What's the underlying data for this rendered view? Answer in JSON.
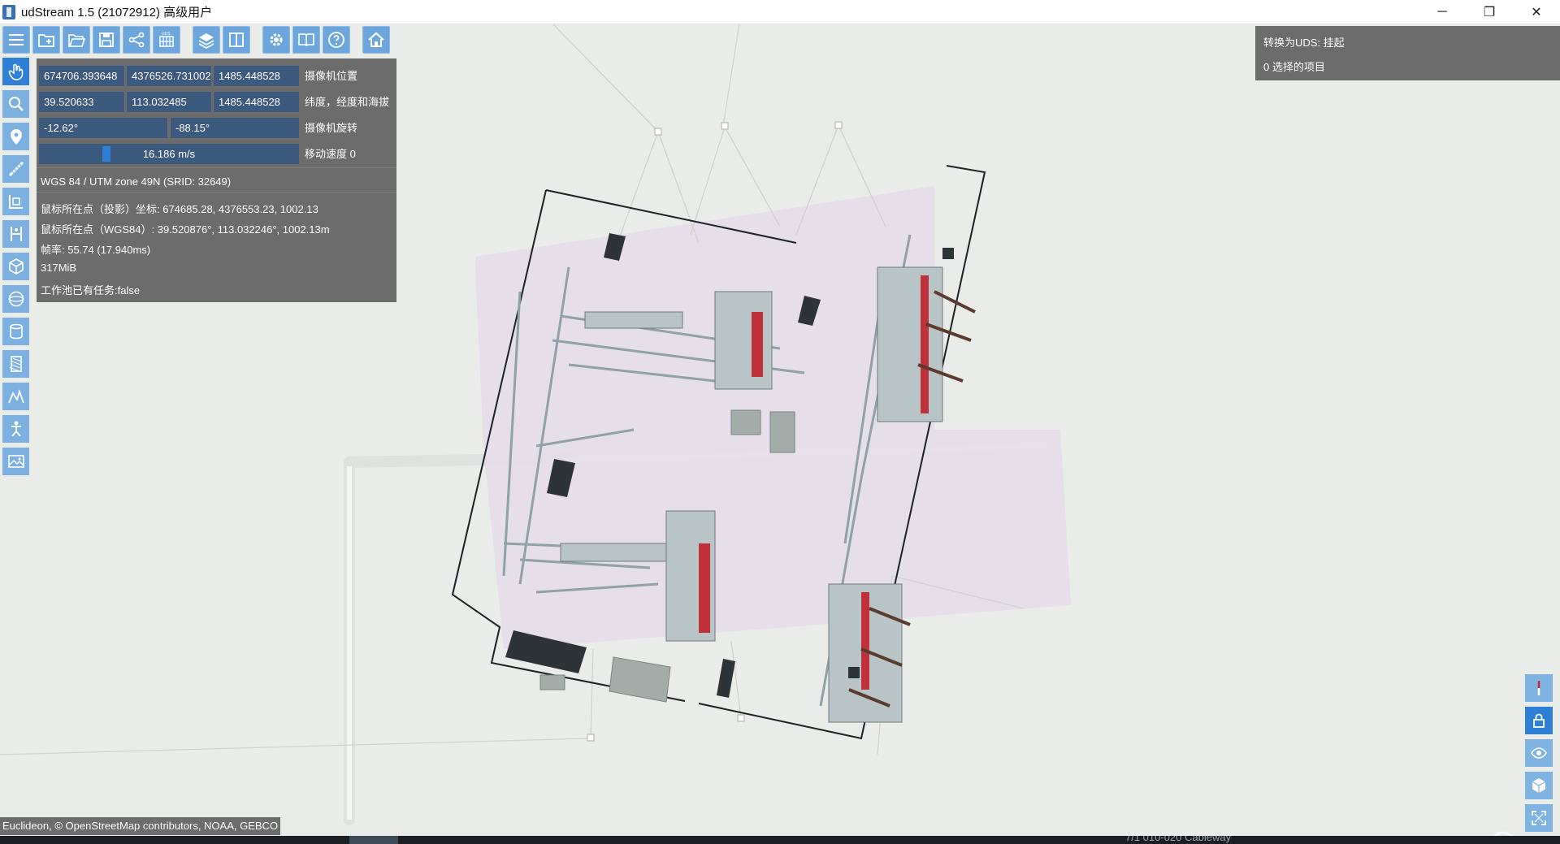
{
  "window": {
    "title": "udStream 1.5 (21072912) 高级用户",
    "minimize": "─",
    "restore": "❐",
    "close": "✕"
  },
  "top_toolbar": [
    {
      "name": "menu-icon"
    },
    {
      "name": "new-project-icon"
    },
    {
      "name": "open-folder-icon"
    },
    {
      "name": "save-icon"
    },
    {
      "name": "share-icon"
    },
    {
      "name": "convert-icon"
    },
    {
      "name": "layers-icon"
    },
    {
      "name": "split-view-icon"
    },
    {
      "name": "settings-icon"
    },
    {
      "name": "book-icon"
    },
    {
      "name": "help-icon"
    },
    {
      "name": "home-icon"
    }
  ],
  "left_toolbar": [
    {
      "name": "hand-pan-icon",
      "active": true
    },
    {
      "name": "search-icon"
    },
    {
      "name": "location-pin-icon"
    },
    {
      "name": "ruler-icon"
    },
    {
      "name": "height-measure-icon"
    },
    {
      "name": "vertical-measure-icon"
    },
    {
      "name": "cube-icon"
    },
    {
      "name": "sphere-icon"
    },
    {
      "name": "cylinder-icon"
    },
    {
      "name": "hatch-icon"
    },
    {
      "name": "polyline-icon"
    },
    {
      "name": "person-icon"
    },
    {
      "name": "image-icon"
    }
  ],
  "camera": {
    "position_x": "674706.393648",
    "position_y": "4376526.731002",
    "position_z": "1485.448528",
    "position_label": "摄像机位置",
    "latitude": "39.520633",
    "longitude": "113.032485",
    "altitude": "1485.448528",
    "latlon_label": "纬度，经度和海拔",
    "rotation_pitch": "-12.62°",
    "rotation_yaw": "-88.15°",
    "rotation_label": "摄像机旋转",
    "speed": "16.186 m/s",
    "speed_label": "移动速度 0",
    "speed_level": 0.25
  },
  "info": {
    "crs": "WGS 84 / UTM zone 49N (SRID: 32649)",
    "mouse_projected": "鼠标所在点（投影）坐标: 674685.28, 4376553.23, 1002.13",
    "mouse_wgs84": "鼠标所在点（WGS84）: 39.520876°, 113.032246°, 1002.13m",
    "fps": "帧率: 55.74 (17.940ms)",
    "memory": "317MiB",
    "work_pool": "工作池已有任务:false"
  },
  "right_panel": {
    "convert_status": "转换为UDS: 挂起",
    "selected_items": "0 选择的项目"
  },
  "right_tools": [
    {
      "name": "compass-north-icon"
    },
    {
      "name": "lock-icon",
      "active": true
    },
    {
      "name": "eye-icon"
    },
    {
      "name": "view-cube-icon"
    },
    {
      "name": "fullscreen-icon"
    }
  ],
  "attribution": "Euclideon, © OpenStreetMap contributors, NOAA, GEBCO",
  "taskbar": {
    "text": "7/1  010-020 Cableway"
  },
  "colors": {
    "toolbar_button": "#6da6dd",
    "active_button": "#2f7fd6",
    "panel_bg": "#6c6c6c",
    "field_bg": "#3c5a7e",
    "ground": "#e9ece9",
    "site_pad": "#e4dbe8"
  }
}
